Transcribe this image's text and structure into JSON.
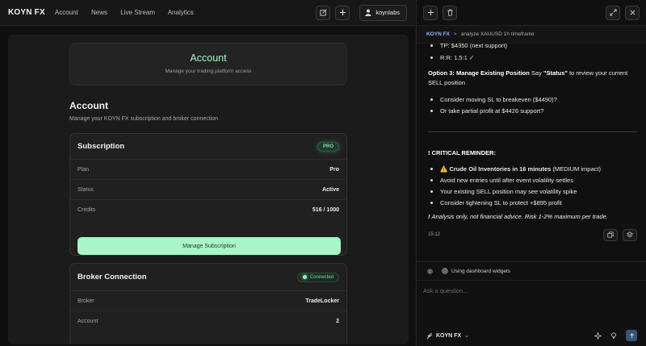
{
  "topbar": {
    "logo": "KOYN FX",
    "nav": [
      "Account",
      "News",
      "Live Stream",
      "Analytics"
    ],
    "user": "koynlabs"
  },
  "hero": {
    "title": "Account",
    "subtitle": "Manage your trading platform access"
  },
  "section": {
    "title": "Account",
    "subtitle": "Manage your KOYN FX subscription and broker connection"
  },
  "subscription": {
    "title": "Subscription",
    "badge": "PRO",
    "rows": [
      {
        "label": "Plan",
        "value": "Pro"
      },
      {
        "label": "Status",
        "value": "Active"
      },
      {
        "label": "Credits",
        "value": "516 / 1000"
      }
    ],
    "button": "Manage Subscription"
  },
  "broker": {
    "title": "Broker Connection",
    "badge": "Connected",
    "rows": [
      {
        "label": "Broker",
        "value": "TradeLocker"
      },
      {
        "label": "Account",
        "value": "2"
      }
    ]
  },
  "chat": {
    "breadcrumb": {
      "brand": "KOYN FX",
      "sep": ">",
      "query": "analyze XAUUSD 1h timeframe"
    },
    "lines": {
      "tp": "TP: $4350 (next support)",
      "rr": "R:R: 1.5:1 ✓",
      "opt3_bold": "Option 3: Manage Existing Position",
      "opt3_rest": " Say ",
      "opt3_status": "\"Status\"",
      "opt3_tail": " to review your current SELL position",
      "b1": "Consider moving SL to breakeven ($4490)?",
      "b2": "Or take partial profit at $4426 support?",
      "reminder": "! CRITICAL REMINDER:",
      "r1_icon": "⚠️",
      "r1_bold": "Crude Oil Inventories in 16 minutes",
      "r1_rest": " (MEDIUM impact)",
      "r2": "Avoid new entries until after event volatility settles",
      "r3": "Your existing SELL position may see volatility spike",
      "r4": "Consider tightening SL to protect +$895 profit",
      "disclaimer_bang": "! ",
      "disclaimer": "Analysis only, not financial advice. Risk 1-2% maximum per trade."
    },
    "time": "15:12",
    "widgets": "Using dashboard widgets",
    "placeholder": "Ask a question...",
    "model": "KOYN FX"
  },
  "colors": {
    "accent": "#a8f5c8",
    "brand_link": "#8fb3ff",
    "bg": "#141414"
  }
}
